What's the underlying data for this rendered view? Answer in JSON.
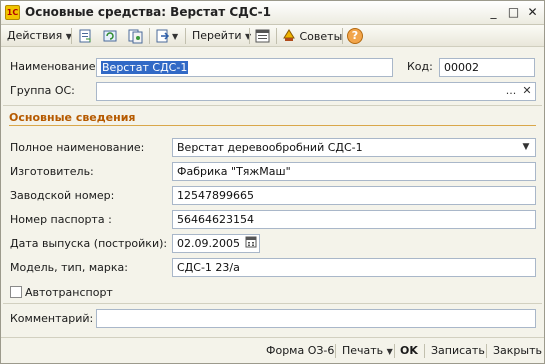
{
  "window": {
    "title": "Основные средства: Верстат СДС-1",
    "controls": {
      "minimize": "_",
      "maximize": "□",
      "close": "✕"
    }
  },
  "toolbar": {
    "actions": "Действия",
    "goto": "Перейти",
    "tips": "Советы",
    "help": "?",
    "icons": [
      "save-copy-icon",
      "refresh-icon",
      "copy-doc-icon",
      "arrow-right-icon",
      "list-structure-icon",
      "tips-icon",
      "help-icon"
    ]
  },
  "form": {
    "name_label": "Наименование:",
    "name_value": "Верстат СДС-1",
    "code_label": "Код:",
    "code_value": "00002",
    "group_label": "Группа ОС:",
    "group_value": "",
    "group_select_btn": "...",
    "group_clear_btn": "✕",
    "section_title": "Основные сведения",
    "full_name_label": "Полное наименование:",
    "full_name_value": "Верстат деревообробний СДС-1",
    "manufacturer_label": "Изготовитель:",
    "manufacturer_value": "Фабрика \"ТяжМаш\"",
    "serial_label": "Заводской номер:",
    "serial_value": "12547899665",
    "passport_label": "Номер паспорта :",
    "passport_value": "56464623154",
    "release_date_label": "Дата выпуска (постройки):",
    "release_date_value": "02.09.2005",
    "model_label": "Модель, тип, марка:",
    "model_value": "СДС-1 23/а",
    "vehicle_label": "Автотранспорт",
    "vehicle_checked": false,
    "comment_label": "Комментарий:",
    "comment_value": ""
  },
  "footer": {
    "form_os6": "Форма ОЗ-6",
    "print": "Печать",
    "ok": "OK",
    "save": "Записать",
    "close": "Закрыть"
  },
  "colors": {
    "section_title": "#b65a00",
    "selection": "#3169c6",
    "field_border": "#a9b7c9",
    "window_bg": "#f4f3ea"
  }
}
